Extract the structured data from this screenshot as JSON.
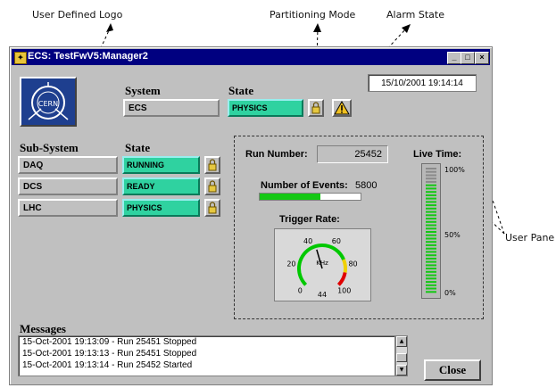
{
  "annotations": {
    "logo": "User Defined Logo",
    "partitioning": "Partitioning Mode",
    "alarm": "Alarm State",
    "userpane": "User Pane"
  },
  "window": {
    "title": "ECS: TestFwV5:Manager2",
    "min_label": "_",
    "max_label": "□",
    "close_label": "×"
  },
  "logo": {
    "text": "CERN"
  },
  "system": {
    "header": "System",
    "state_header": "State",
    "name": "ECS",
    "state": "PHYSICS",
    "datetime": "15/10/2001  19:14:14"
  },
  "subsystems": {
    "header": "Sub-System",
    "state_header": "State",
    "items": [
      {
        "name": "DAQ",
        "state": "RUNNING"
      },
      {
        "name": "DCS",
        "state": "READY"
      },
      {
        "name": "LHC",
        "state": "PHYSICS"
      }
    ]
  },
  "userpane": {
    "run_label": "Run Number:",
    "run_number": "25452",
    "events_label": "Number of Events:",
    "events_value": "5800",
    "events_fraction": 0.6,
    "trigger_label": "Trigger Rate:",
    "gauge": {
      "unit": "KHz",
      "ticks": [
        "0",
        "20",
        "40",
        "60",
        "80",
        "100"
      ],
      "value_text": "44",
      "value": 44
    },
    "live_label": "Live Time:",
    "live_ticks": [
      "100%",
      "50%",
      "0%"
    ],
    "live_fraction": 1.0
  },
  "messages": {
    "header": "Messages",
    "lines": [
      "15-Oct-2001 19:13:09 - Run 25451 Stopped",
      "15-Oct-2001 19:13:13 - Run 25451 Stopped",
      "15-Oct-2001 19:13:14 - Run 25452 Started"
    ]
  },
  "close_button": {
    "label": "Close"
  },
  "colors": {
    "state_green": "#2fd2a0",
    "titlebar": "#000080",
    "window_bg": "#c0c0c0",
    "progress_green": "#14c814",
    "gauge_green": "#00c800",
    "gauge_red": "#e00000",
    "gauge_yellow": "#f0d000"
  }
}
